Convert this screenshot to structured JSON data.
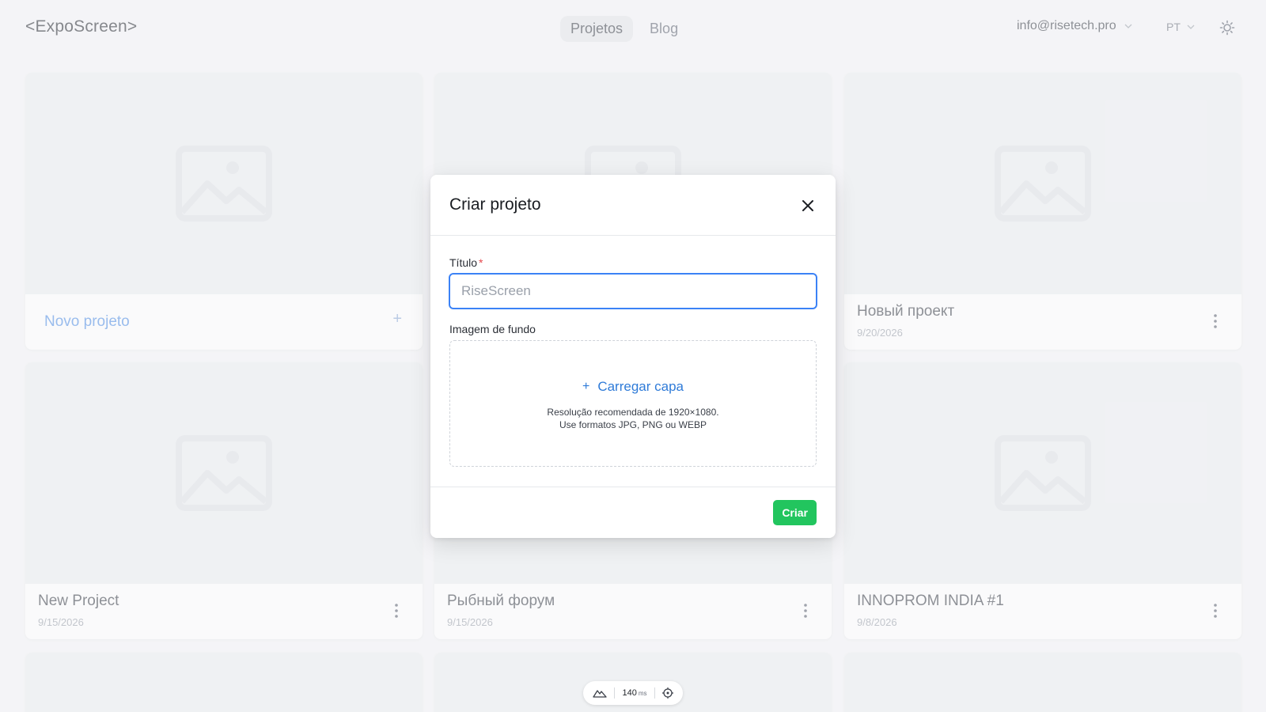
{
  "header": {
    "logo": "<ExpoScreen>",
    "nav": [
      {
        "label": "Projetos",
        "active": true
      },
      {
        "label": "Blog",
        "active": false
      }
    ],
    "account_email": "info@risetech.pro",
    "language": "PT",
    "theme_icon": "sun-icon"
  },
  "cards": {
    "new_project_label": "Novo projeto",
    "items": [
      {
        "title": "Новый проект",
        "date": "9/20/2026"
      },
      {
        "title": "New Project",
        "date": "9/15/2026"
      },
      {
        "title": "Рыбный форум",
        "date": "9/15/2026"
      },
      {
        "title": "INNOPROM INDIA #1",
        "date": "9/8/2026"
      }
    ]
  },
  "modal": {
    "title": "Criar projeto",
    "title_field_label": "Título",
    "required_mark": "*",
    "title_field_placeholder": "RiseScreen",
    "background_label": "Imagem de fundo",
    "upload_label": "Carregar capa",
    "upload_hint_line1": "Resolução recomendada de 1920×1080.",
    "upload_hint_line2": "Use formatos JPG, PNG ou WEBP",
    "create_button": "Criar"
  },
  "perf": {
    "value": "140",
    "unit": "ms"
  },
  "colors": {
    "accent": "#3b82f6",
    "primary_action": "#22c55e",
    "link": "#2f7bd8"
  }
}
